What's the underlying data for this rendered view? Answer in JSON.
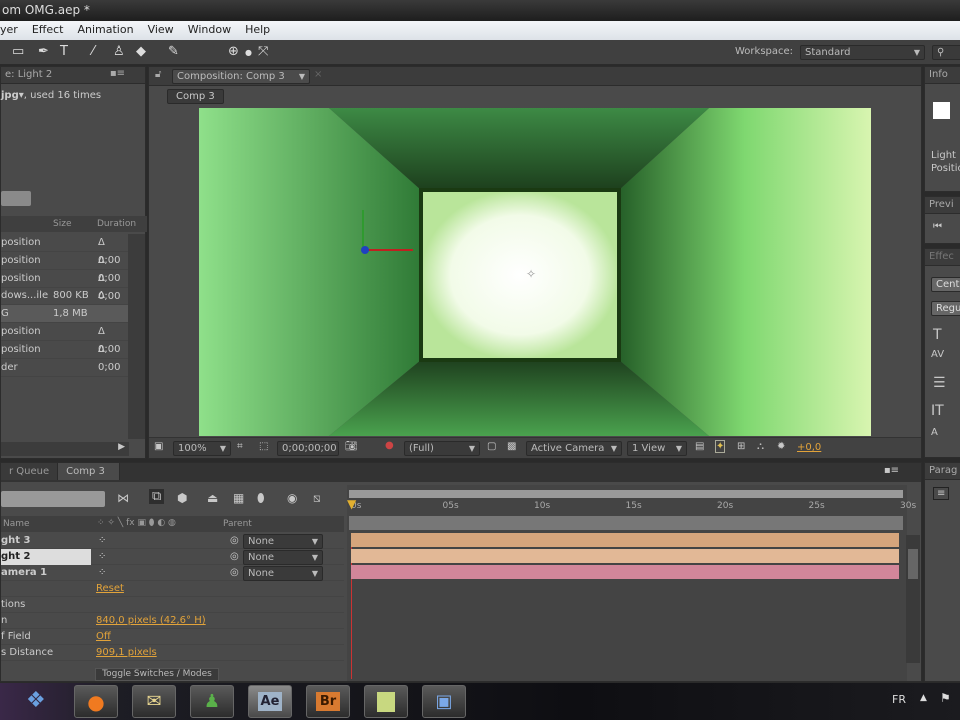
{
  "window": {
    "title": "om OMG.aep *"
  },
  "menu": [
    "yer",
    "Effect",
    "Animation",
    "View",
    "Window",
    "Help"
  ],
  "toolbar": {
    "workspace_label": "Workspace:",
    "workspace_value": "Standard"
  },
  "project": {
    "panel_title": "e: Light 2",
    "footage_name": "jpg▾",
    "usage": ", used 16 times",
    "columns": {
      "size": "Size",
      "duration": "Duration"
    },
    "items": [
      {
        "name": "position",
        "size": "",
        "duration": "Δ 0;00"
      },
      {
        "name": "position",
        "size": "",
        "duration": "Δ 0;00"
      },
      {
        "name": "position",
        "size": "",
        "duration": "Δ 0;00"
      },
      {
        "name": "dows...ile",
        "size": "800 KB",
        "duration": "Δ 0;00"
      },
      {
        "name": "G",
        "size": "1,8 MB",
        "duration": ""
      },
      {
        "name": "position",
        "size": "",
        "duration": "Δ 0;00"
      },
      {
        "name": "position",
        "size": "",
        "duration": "Δ 0;00"
      },
      {
        "name": "der",
        "size": "",
        "duration": ""
      }
    ]
  },
  "composition": {
    "tab_label": "Composition: Comp 3",
    "breadcrumb": "Comp 3",
    "viewer_bar": {
      "zoom": "100%",
      "timecode": "0;00;00;00",
      "resolution": "(Full)",
      "camera": "Active Camera",
      "views": "1 View",
      "exposure": "+0,0"
    }
  },
  "info": {
    "title": "Info",
    "light_label": "Light",
    "position_label": "Positio"
  },
  "preview": {
    "title": "Previ"
  },
  "effects": {
    "title": "Effec",
    "font": "Centu",
    "style": "Regul"
  },
  "paragraph": {
    "title": "Parag"
  },
  "timeline": {
    "tabs": [
      "r Queue",
      "Comp 3"
    ],
    "columns": {
      "name": "Name",
      "parent": "Parent"
    },
    "layers": [
      {
        "name": "ght 3",
        "parent": "None"
      },
      {
        "name": "ght 2",
        "parent": "None"
      },
      {
        "name": "amera 1",
        "parent": "None"
      }
    ],
    "properties": [
      {
        "name": "",
        "value": "Reset"
      },
      {
        "name": "tions",
        "value": ""
      },
      {
        "name": "n",
        "value": "840,0 pixels (42,6° H)"
      },
      {
        "name": "f Field",
        "value": "Off"
      },
      {
        "name": "s Distance",
        "value": "909,1 pixels"
      }
    ],
    "ruler": [
      "0s",
      "05s",
      "10s",
      "15s",
      "20s",
      "25s",
      "30s"
    ],
    "toggle_label": "Toggle Switches / Modes",
    "bar_colors": [
      "#d6a57c",
      "#e2b896",
      "#d2869a"
    ]
  },
  "taskbar": {
    "apps": [
      "Firefox",
      "Mail",
      "Messenger",
      "Ae",
      "Br",
      "Notes",
      "Windows Media"
    ],
    "language": "FR"
  }
}
